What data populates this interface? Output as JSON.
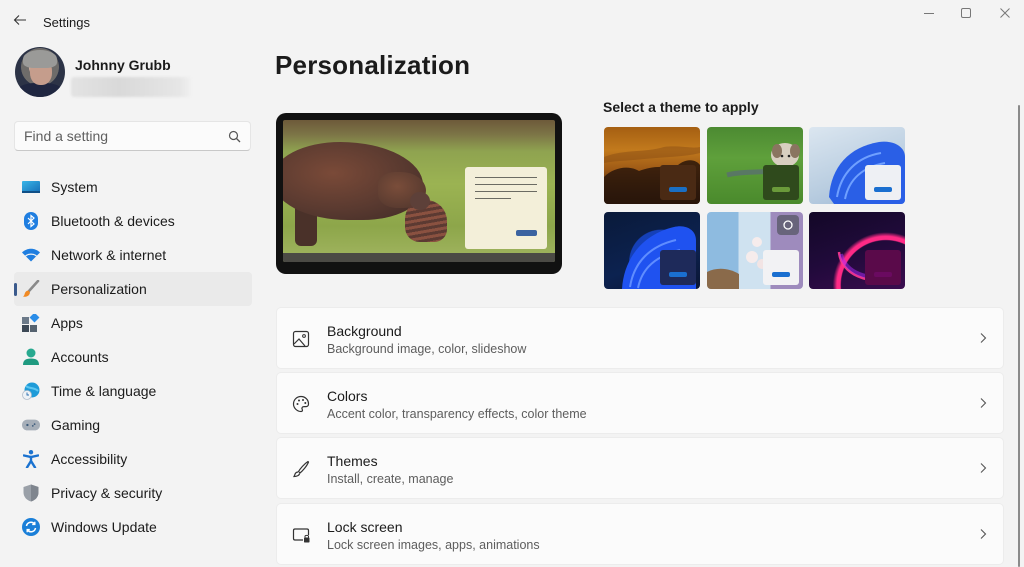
{
  "window": {
    "app_title": "Settings",
    "controls": {
      "minimize": "minimize",
      "maximize": "maximize",
      "close": "close"
    }
  },
  "profile": {
    "name": "Johnny Grubb",
    "email_redacted": true
  },
  "search": {
    "placeholder": "Find a setting",
    "value": ""
  },
  "sidebar": {
    "items": [
      {
        "label": "System",
        "icon": "monitor-icon",
        "selected": false
      },
      {
        "label": "Bluetooth & devices",
        "icon": "bluetooth-icon",
        "selected": false
      },
      {
        "label": "Network & internet",
        "icon": "wifi-icon",
        "selected": false
      },
      {
        "label": "Personalization",
        "icon": "paintbrush-icon",
        "selected": true
      },
      {
        "label": "Apps",
        "icon": "apps-icon",
        "selected": false
      },
      {
        "label": "Accounts",
        "icon": "person-icon",
        "selected": false
      },
      {
        "label": "Time & language",
        "icon": "globe-clock-icon",
        "selected": false
      },
      {
        "label": "Gaming",
        "icon": "gamepad-icon",
        "selected": false
      },
      {
        "label": "Accessibility",
        "icon": "accessibility-icon",
        "selected": false
      },
      {
        "label": "Privacy & security",
        "icon": "shield-icon",
        "selected": false
      },
      {
        "label": "Windows Update",
        "icon": "update-icon",
        "selected": false
      }
    ]
  },
  "main": {
    "page_title": "Personalization",
    "themes_title": "Select a theme to apply",
    "themes": [
      {
        "name": "theme-sunset-elephants",
        "window_color": "#4a2a14",
        "button_color": "#1a6fc4"
      },
      {
        "name": "theme-dog-grass",
        "window_color": "#2f4a1c",
        "button_color": "#6a9a3a"
      },
      {
        "name": "theme-windows-light",
        "window_color": "#eef0f4",
        "button_color": "#1a6fd0"
      },
      {
        "name": "theme-windows-dark",
        "window_color": "#1e2a5a",
        "button_color": "#1a6fd0"
      },
      {
        "name": "theme-flowers-collage",
        "window_color": "#f2f2f4",
        "button_color": "#1a6fd0"
      },
      {
        "name": "theme-glow-purple",
        "window_color": "#5a0a4a",
        "button_color": "#6a0a60"
      }
    ],
    "cards": [
      {
        "title": "Background",
        "subtitle": "Background image, color, slideshow",
        "icon": "image-icon"
      },
      {
        "title": "Colors",
        "subtitle": "Accent color, transparency effects, color theme",
        "icon": "palette-icon"
      },
      {
        "title": "Themes",
        "subtitle": "Install, create, manage",
        "icon": "brush-icon"
      },
      {
        "title": "Lock screen",
        "subtitle": "Lock screen images, apps, animations",
        "icon": "lock-screen-icon"
      }
    ]
  },
  "colors": {
    "accent": "#3a5a8c",
    "background": "#f3f3f3",
    "card": "#fbfbfb"
  }
}
